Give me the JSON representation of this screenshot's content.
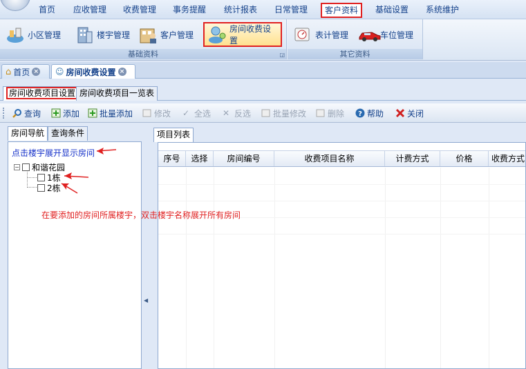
{
  "menu": {
    "items": [
      "首页",
      "应收管理",
      "收费管理",
      "事务提醒",
      "统计报表",
      "日常管理",
      "客户资料",
      "基础设置",
      "系统维护"
    ],
    "active": "客户资料"
  },
  "ribbon": {
    "groups": [
      {
        "title": "基础资料",
        "buttons": [
          "小区管理",
          "楼宇管理",
          "客户管理",
          "房间收费设置"
        ]
      },
      {
        "title": "其它资料",
        "buttons": [
          "表计管理",
          "车位管理"
        ]
      }
    ],
    "selected": "房间收费设置"
  },
  "doc_tabs": [
    {
      "label": "首页",
      "icon": "home-icon"
    },
    {
      "label": "房间收费设置",
      "icon": "person-room-icon"
    }
  ],
  "inner_tabs": [
    "房间收费项目设置",
    "房间收费项目一览表"
  ],
  "toolbar": {
    "buttons": [
      {
        "label": "查询",
        "icon": "search-icon",
        "enabled": true
      },
      {
        "label": "添加",
        "icon": "add-icon",
        "enabled": true
      },
      {
        "label": "批量添加",
        "icon": "batch-add-icon",
        "enabled": true
      },
      {
        "label": "修改",
        "icon": "edit-icon",
        "enabled": false
      },
      {
        "label": "全选",
        "icon": "check-icon",
        "enabled": false
      },
      {
        "label": "反选",
        "icon": "invert-icon",
        "enabled": false
      },
      {
        "label": "批量修改",
        "icon": "batch-edit-icon",
        "enabled": false
      },
      {
        "label": "删除",
        "icon": "delete-icon",
        "enabled": false
      },
      {
        "label": "帮助",
        "icon": "help-icon",
        "enabled": true
      },
      {
        "label": "关闭",
        "icon": "close-icon",
        "enabled": true
      }
    ]
  },
  "left_panel": {
    "tabs": [
      "房间导航",
      "查询条件"
    ],
    "hint": "点击楼宇展开显示房间",
    "tree": {
      "root": "和谐花园",
      "children": [
        "1栋",
        "2栋"
      ]
    }
  },
  "right_panel": {
    "tab": "项目列表",
    "columns": [
      "序号",
      "选择",
      "房间编号",
      "收费项目名称",
      "计费方式",
      "价格",
      "收费方式"
    ]
  },
  "annotation": "在要添加的房间所属楼宇，双击楼宇名称展开所有房间",
  "colors": {
    "highlight": "#e02020",
    "hint_blue": "#1530c9",
    "menu_text": "#15428b"
  }
}
